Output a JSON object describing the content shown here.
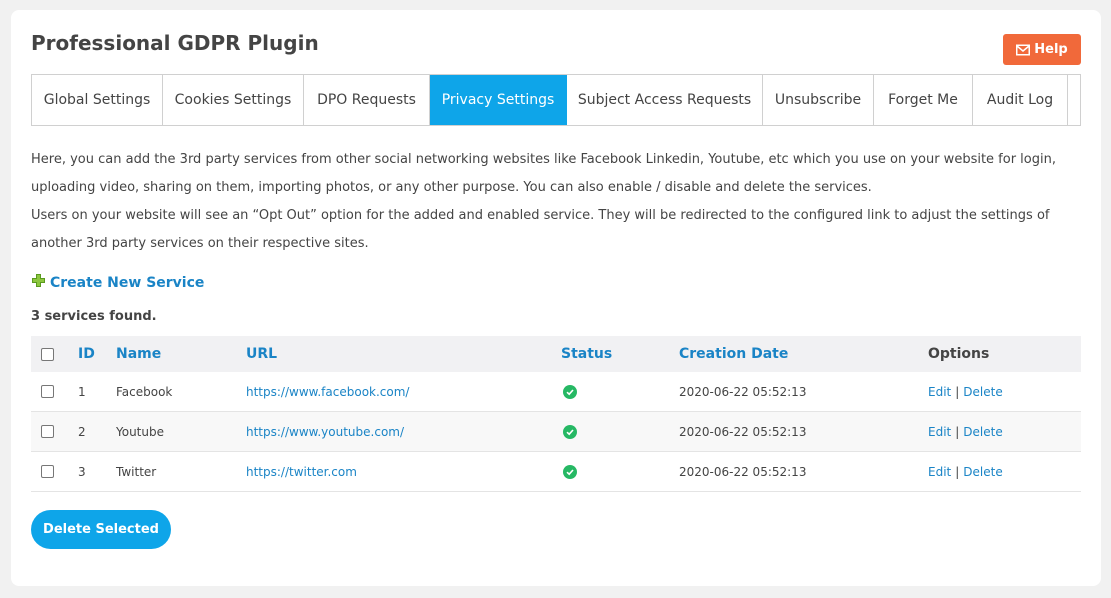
{
  "page_title": "Professional GDPR Plugin",
  "help_label": "Help",
  "tabs": [
    {
      "label": "Global Settings",
      "active": false
    },
    {
      "label": "Cookies Settings",
      "active": false
    },
    {
      "label": "DPO Requests",
      "active": false
    },
    {
      "label": "Privacy Settings",
      "active": true
    },
    {
      "label": "Subject Access Requests",
      "active": false
    },
    {
      "label": "Unsubscribe",
      "active": false
    },
    {
      "label": "Forget Me",
      "active": false
    },
    {
      "label": "Audit Log",
      "active": false
    }
  ],
  "description": {
    "line1": "Here, you can add the 3rd party services from other social networking websites like Facebook Linkedin, Youtube, etc which you use on your website for login, uploading video, sharing on them, importing photos, or any other purpose. You can also enable / disable and delete the services.",
    "line2": "Users on your website will see an “Opt Out” option for the added and enabled service. They will be redirected to the configured link to adjust the settings of another 3rd party services on their respective sites."
  },
  "create_service_label": "Create New Service",
  "services_found": "3 services found.",
  "table": {
    "headers": {
      "id": "ID",
      "name": "Name",
      "url": "URL",
      "status": "Status",
      "created": "Creation Date",
      "options": "Options"
    },
    "rows": [
      {
        "id": "1",
        "name": "Facebook",
        "url": "https://www.facebook.com/",
        "status": "enabled",
        "created": "2020-06-22 05:52:13"
      },
      {
        "id": "2",
        "name": "Youtube",
        "url": "https://www.youtube.com/",
        "status": "enabled",
        "created": "2020-06-22 05:52:13"
      },
      {
        "id": "3",
        "name": "Twitter",
        "url": "https://twitter.com",
        "status": "enabled",
        "created": "2020-06-22 05:52:13"
      }
    ],
    "edit_label": "Edit",
    "separator": "|",
    "delete_label": "Delete"
  },
  "delete_selected_label": "Delete Selected",
  "colors": {
    "accent": "#0ea5e9",
    "link": "#1a84c6",
    "help": "#f1693a",
    "status_enabled": "#26b864"
  },
  "icons": {
    "help": "envelope-icon",
    "create": "plus-icon",
    "status": "check-circle-icon"
  }
}
